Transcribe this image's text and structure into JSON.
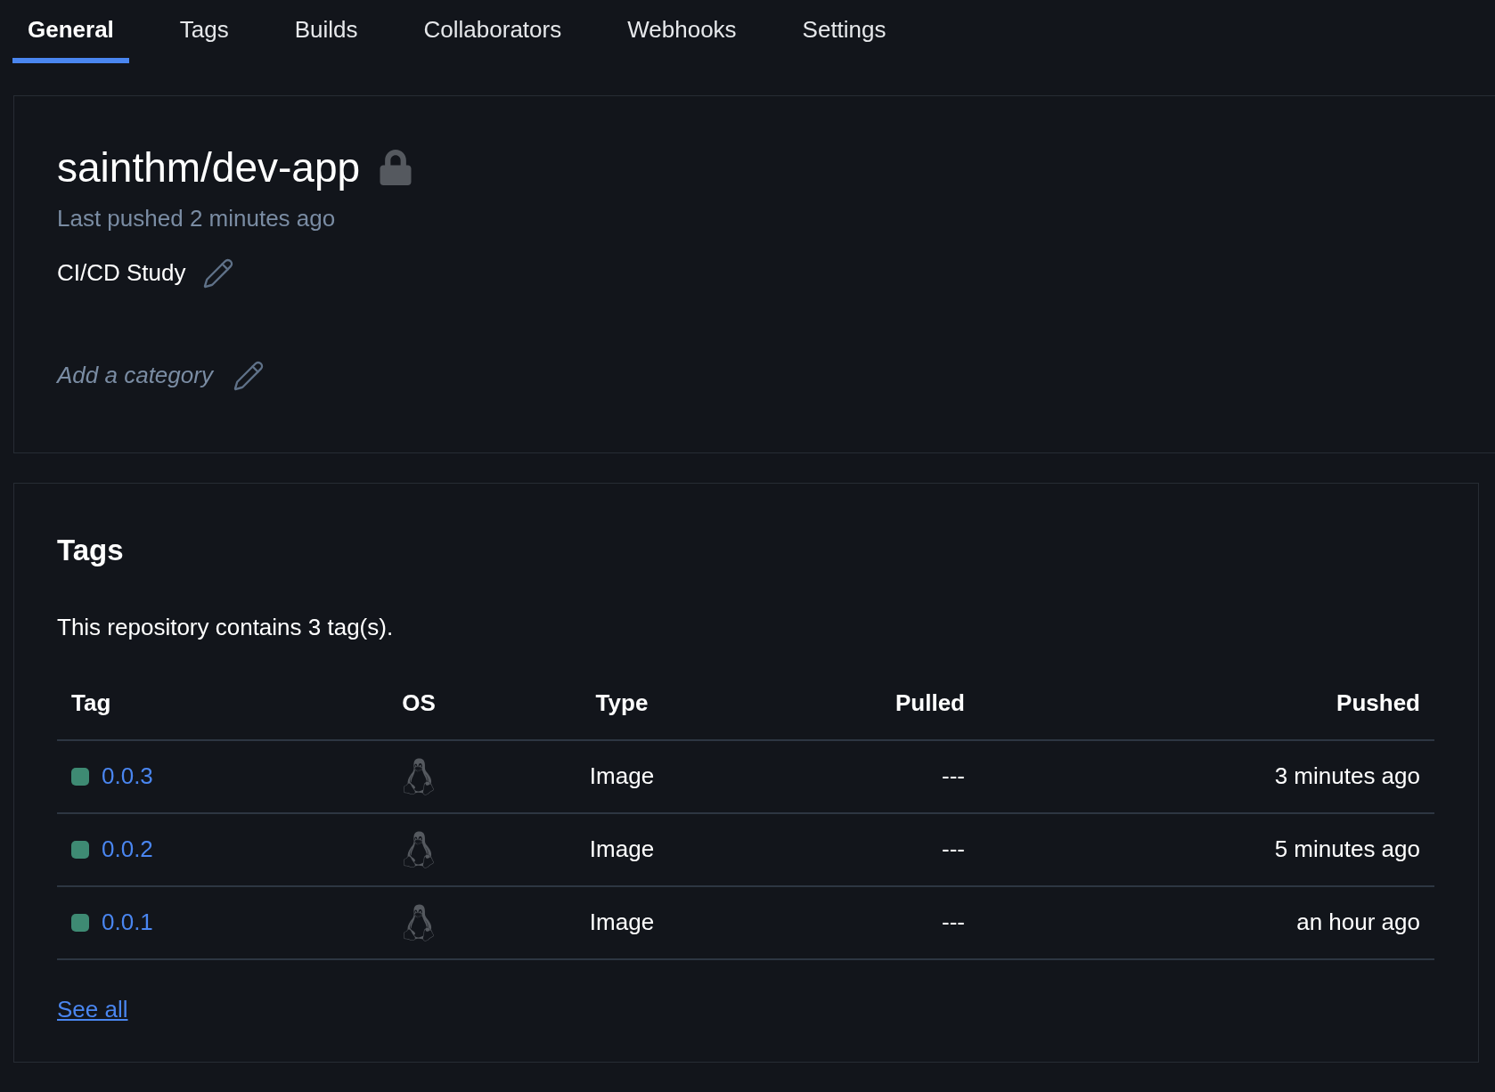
{
  "tabs": [
    {
      "label": "General",
      "selected": true
    },
    {
      "label": "Tags",
      "selected": false
    },
    {
      "label": "Builds",
      "selected": false
    },
    {
      "label": "Collaborators",
      "selected": false
    },
    {
      "label": "Webhooks",
      "selected": false
    },
    {
      "label": "Settings",
      "selected": false
    }
  ],
  "repository": {
    "name": "sainthm/dev-app",
    "private": true,
    "last_pushed": "Last pushed 2 minutes ago",
    "description": "CI/CD Study",
    "category_placeholder": "Add a category"
  },
  "tags_section": {
    "title": "Tags",
    "summary": "This repository contains 3 tag(s).",
    "table": {
      "columns": [
        "Tag",
        "OS",
        "Type",
        "Pulled",
        "Pushed"
      ],
      "rows": [
        {
          "tag": "0.0.3",
          "color": "#3e8a73",
          "type": "Image",
          "pulled": "---",
          "pushed": "3 minutes ago"
        },
        {
          "tag": "0.0.2",
          "color": "#3e8a73",
          "type": "Image",
          "pulled": "---",
          "pushed": "5 minutes ago"
        },
        {
          "tag": "0.0.1",
          "color": "#3e8a73",
          "type": "Image",
          "pulled": "---",
          "pushed": "an hour ago"
        }
      ]
    },
    "see_all": "See all"
  }
}
